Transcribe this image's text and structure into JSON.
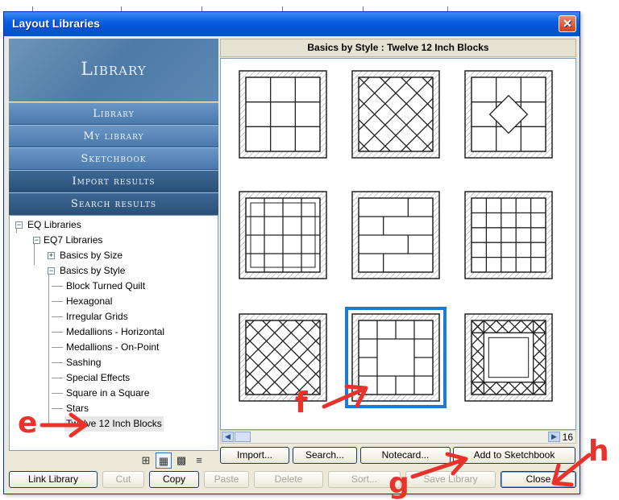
{
  "window": {
    "title": "Layout Libraries",
    "close_glyph": "✕"
  },
  "left": {
    "header": "Library",
    "nav": [
      {
        "label": "Library"
      },
      {
        "label": "My library"
      },
      {
        "label": "Sketchbook"
      },
      {
        "label": "Import results"
      },
      {
        "label": "Search results"
      }
    ],
    "tree": {
      "root": "EQ Libraries",
      "child": "EQ7 Libraries",
      "size": "Basics by Size",
      "style": "Basics by Style",
      "leaves": [
        "Block Turned Quilt",
        "Hexagonal",
        "Irregular Grids",
        "Medallions - Horizontal",
        "Medallions - On-Point",
        "Sashing",
        "Special Effects",
        "Square in a Square",
        "Stars",
        "Twelve 12 Inch Blocks"
      ],
      "selected_leaf": "Twelve 12 Inch Blocks"
    },
    "view_icons": [
      "large-grid-icon",
      "medium-grid-icon",
      "small-grid-icon",
      "list-icon"
    ]
  },
  "right": {
    "title": "Basics by Style  :  Twelve 12 Inch Blocks",
    "selected_index": 7,
    "page": "16",
    "blocks": [
      {
        "pattern": "grid3"
      },
      {
        "pattern": "lattice"
      },
      {
        "pattern": "diamond"
      },
      {
        "pattern": "grid4"
      },
      {
        "pattern": "bricks"
      },
      {
        "pattern": "ladder"
      },
      {
        "pattern": "lattice2"
      },
      {
        "pattern": "medallion"
      },
      {
        "pattern": "framed"
      }
    ]
  },
  "buttons": {
    "import": "Import...",
    "search": "Search...",
    "notecard": "Notecard...",
    "add_to_sketchbook": "Add to Sketchbook",
    "link_library": "Link Library",
    "cut": "Cut",
    "copy": "Copy",
    "paste": "Paste",
    "delete": "Delete",
    "sort": "Sort...",
    "save_library": "Save Library",
    "close": "Close"
  },
  "annotations": {
    "e": "e",
    "f": "f",
    "g": "g",
    "h": "h"
  },
  "colors": {
    "arrow": "#e8332c",
    "selection": "#1e7bd4",
    "title_bar": "#0a5fe0"
  }
}
